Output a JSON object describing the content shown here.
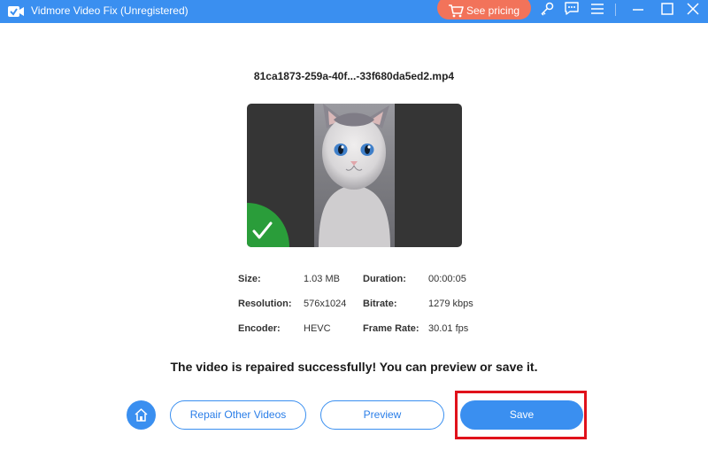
{
  "app": {
    "title": "Vidmore Video Fix (Unregistered)",
    "pricing_label": "See pricing",
    "accent_color": "#3a8ff0",
    "pricing_color": "#f2735a",
    "icons": [
      "key-icon",
      "feedback-icon",
      "menu-icon",
      "minimize-icon",
      "maximize-icon",
      "close-icon"
    ]
  },
  "video": {
    "filename": "81ca1873-259a-40f...-33f680da5ed2.mp4",
    "status_icon": "check-icon"
  },
  "info": {
    "size_label": "Size:",
    "size_value": "1.03 MB",
    "duration_label": "Duration:",
    "duration_value": "00:00:05",
    "resolution_label": "Resolution:",
    "resolution_value": "576x1024",
    "bitrate_label": "Bitrate:",
    "bitrate_value": "1279 kbps",
    "encoder_label": "Encoder:",
    "encoder_value": "HEVC",
    "framerate_label": "Frame Rate:",
    "framerate_value": "30.01 fps"
  },
  "message": "The video is repaired successfully! You can preview or save it.",
  "actions": {
    "home_icon": "home-icon",
    "repair_other": "Repair Other Videos",
    "preview": "Preview",
    "save": "Save"
  }
}
